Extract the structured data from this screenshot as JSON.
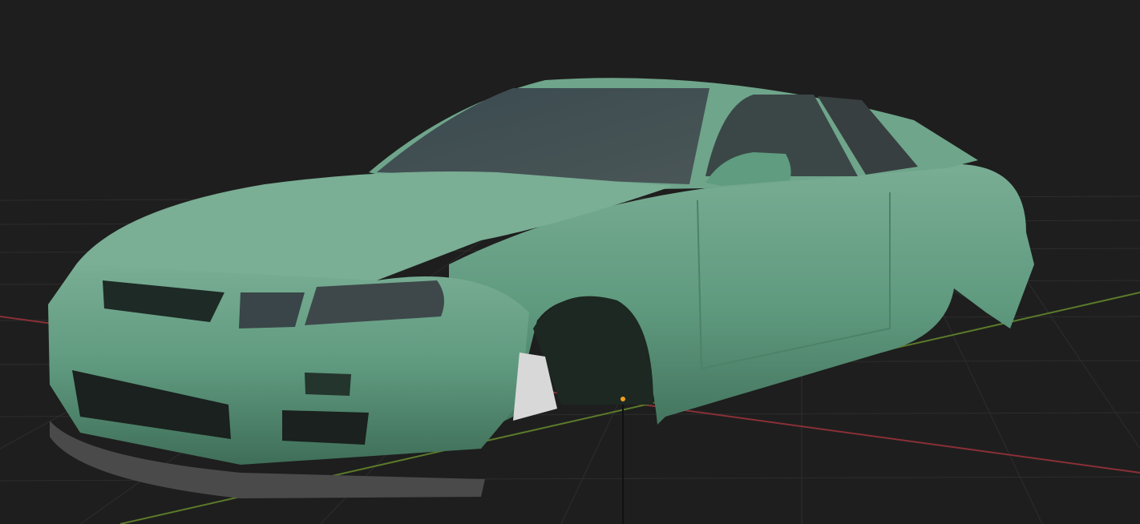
{
  "viewport": {
    "kind": "3d-viewport",
    "object": "car-body-model",
    "colors": {
      "background": "#1e1e1e",
      "grid": "#2c2c2c",
      "x_axis": "#8a2f37",
      "y_axis": "#5b7a2a",
      "body_paint": "#5e9a7d",
      "glass": "#3e4a4c",
      "origin_point": "#f0a020"
    }
  }
}
